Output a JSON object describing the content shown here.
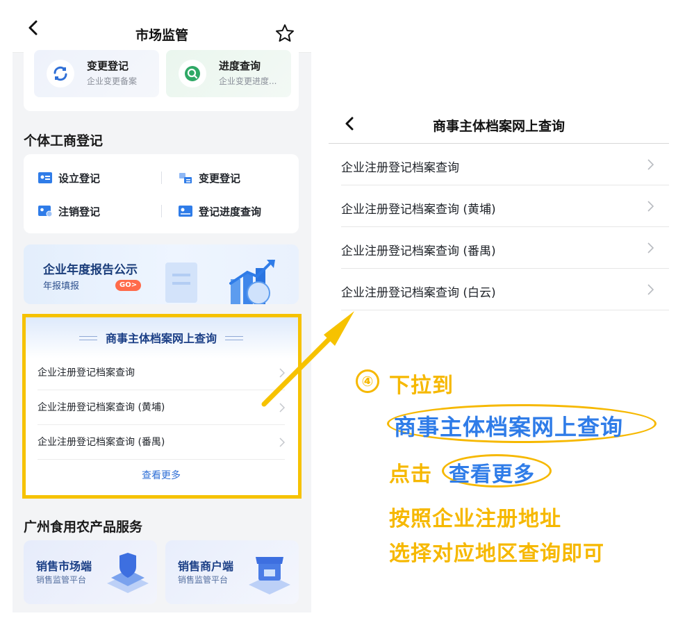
{
  "left_screen": {
    "nav": {
      "title": "市场监管"
    },
    "top_tiles": [
      {
        "title": "变更登记",
        "subtitle": "企业变更备案"
      },
      {
        "title": "进度查询",
        "subtitle": "企业变更进度..."
      }
    ],
    "individual_section": {
      "title": "个体工商登记",
      "items": [
        "设立登记",
        "变更登记",
        "注销登记",
        "登记进度查询"
      ]
    },
    "annual_banner": {
      "title": "企业年度报告公示",
      "subtitle": "年报填报",
      "badge": "GO>"
    },
    "archive_card": {
      "title": "商事主体档案网上查询",
      "rows": [
        "企业注册登记档案查询",
        "企业注册登记档案查询 (黄埔)",
        "企业注册登记档案查询 (番禺)"
      ],
      "more": "查看更多"
    },
    "food_section": {
      "title": "广州食用农产品服务",
      "cards": [
        {
          "title": "销售市场端",
          "subtitle": "销售监管平台"
        },
        {
          "title": "销售商户端",
          "subtitle": "销售监管平台"
        }
      ]
    }
  },
  "right_screen": {
    "nav": {
      "title": "商事主体档案网上查询"
    },
    "rows": [
      "企业注册登记档案查询",
      "企业注册登记档案查询 (黄埔)",
      "企业注册登记档案查询 (番禺)",
      "企业注册登记档案查询 (白云)"
    ]
  },
  "annotation": {
    "step": "④",
    "line1": "下拉到",
    "line2": "商事主体档案网上查询",
    "line3_prefix": "点击",
    "line3_link": "查看更多",
    "line4": "按照企业注册地址",
    "line5": "选择对应地区查询即可"
  },
  "colors": {
    "highlight": "#f6c200",
    "accent_blue": "#2f7ce8",
    "annotation_text": "#f6b800"
  },
  "icons": {
    "nav": [
      "back-chevron-icon",
      "star-icon"
    ],
    "tiles": [
      "refresh-icon",
      "search-icon"
    ],
    "individual": [
      "id-card-icon",
      "swap-icon",
      "cancel-card-icon",
      "progress-icon"
    ]
  }
}
